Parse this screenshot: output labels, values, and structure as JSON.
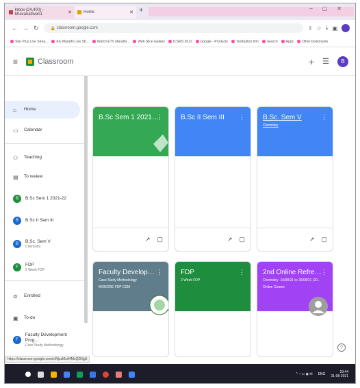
{
  "browser": {
    "tabs": [
      {
        "label": "Inbox (24,400) - bhavanatiwari1"
      },
      {
        "label": "Home"
      }
    ],
    "url": "classroom.google.com",
    "bookmarks": [
      "Star Plus Live Strea...",
      "Etv Marathi Live Str...",
      "Watch ETV Marathi...",
      "Web Slice Gallery",
      "ICSRS 2013",
      "Google - Products",
      "Testbutton.htm",
      "Search",
      "Apps",
      "Other bookmarks"
    ],
    "status_url": "https://classroom.google.com/c/NjczMzA4MzQ2Njg5"
  },
  "app": {
    "name": "Classroom",
    "user_initial": "B"
  },
  "sidebar": {
    "items": [
      {
        "label": "Home",
        "icon": "home-icon"
      },
      {
        "label": "Calendar",
        "icon": "calendar-icon"
      },
      {
        "label": "Teaching",
        "icon": "people-icon"
      },
      {
        "label": "To review",
        "icon": "review-icon"
      },
      {
        "label": "B.Sc Sem 1 2021-22",
        "initial": "B",
        "color": "#1e8e3e"
      },
      {
        "label": "B.Sc II Sem III",
        "initial": "B",
        "color": "#1967d2"
      },
      {
        "label": "B.Sc. Sem V",
        "sub": "Chemistry",
        "initial": "B",
        "color": "#1967d2"
      },
      {
        "label": "FDP",
        "sub": "2 Week FDP",
        "initial": "F",
        "color": "#1e8e3e"
      },
      {
        "label": "Enrolled",
        "icon": "school-icon"
      },
      {
        "label": "To-do",
        "icon": "todo-icon"
      },
      {
        "label": "Faculty Development Prog...",
        "sub": "Case Study Methodology",
        "initial": "F",
        "color": "#1967d2"
      }
    ]
  },
  "cards": [
    {
      "title": "B.Sc Sem 1 2021-22",
      "subtitle": "",
      "sub2": "",
      "color": "#34a853"
    },
    {
      "title": "B.Sc II Sem III",
      "subtitle": "",
      "sub2": "",
      "color": "#4285f4"
    },
    {
      "title": "B.Sc. Sem V",
      "subtitle": "Chemistry",
      "sub2": "",
      "color": "#4285f4"
    },
    {
      "title": "Faculty Development...",
      "subtitle": "Case Study Methodology",
      "sub2": "MONCRE FDP CSM",
      "color": "#607d8b"
    },
    {
      "title": "FDP",
      "subtitle": "2 Week FDP",
      "sub2": "",
      "color": "#1e8e3e"
    },
    {
      "title": "2nd Online Refresher...",
      "subtitle": "Chemistry- 16/08/21 to 29/08/21 (20...",
      "sub2": "Online Course",
      "color": "#a142f4"
    }
  ],
  "taskbar": {
    "lang": "ENG",
    "time": "23:44",
    "date": "31-08-2021"
  }
}
